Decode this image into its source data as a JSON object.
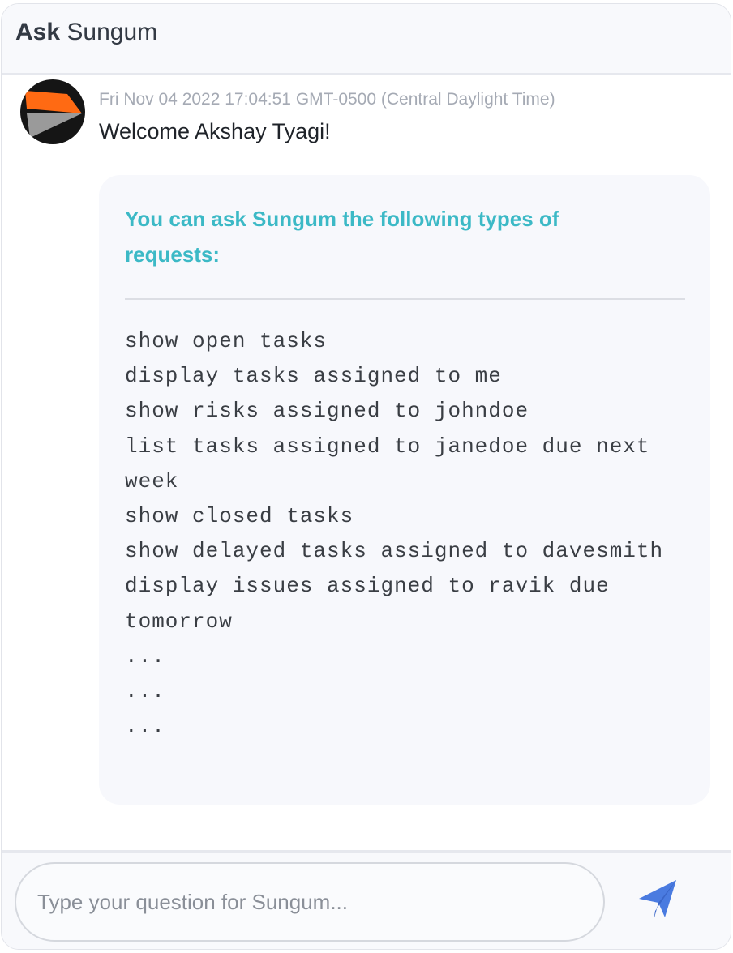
{
  "header": {
    "title_bold": "Ask",
    "title_rest": "Sungum"
  },
  "message": {
    "avatar_icon": "sungum-logo-icon",
    "timestamp": "Fri Nov 04 2022 17:04:51 GMT-0500 (Central Daylight Time)",
    "welcome": "Welcome Akshay Tyagi!"
  },
  "help_card": {
    "title": "You can ask Sungum the following types of requests:",
    "examples": [
      "show open tasks",
      "display tasks assigned to me",
      "show risks assigned to johndoe",
      "list tasks assigned to janedoe due next week",
      "show closed tasks",
      "show delayed tasks assigned to davesmith",
      "display issues assigned to ravik due tomorrow",
      "...",
      "...",
      "..."
    ]
  },
  "input": {
    "placeholder": "Type your question for Sungum...",
    "value": ""
  },
  "send": {
    "icon": "send-icon",
    "color": "#4a7be0"
  },
  "colors": {
    "accent": "#3cb9c6",
    "header_bg": "#f8f9fc",
    "card_bg": "#f7f8fc",
    "logo_orange": "#ff6a13",
    "logo_grey": "#9a9a9a",
    "logo_black": "#151515"
  }
}
